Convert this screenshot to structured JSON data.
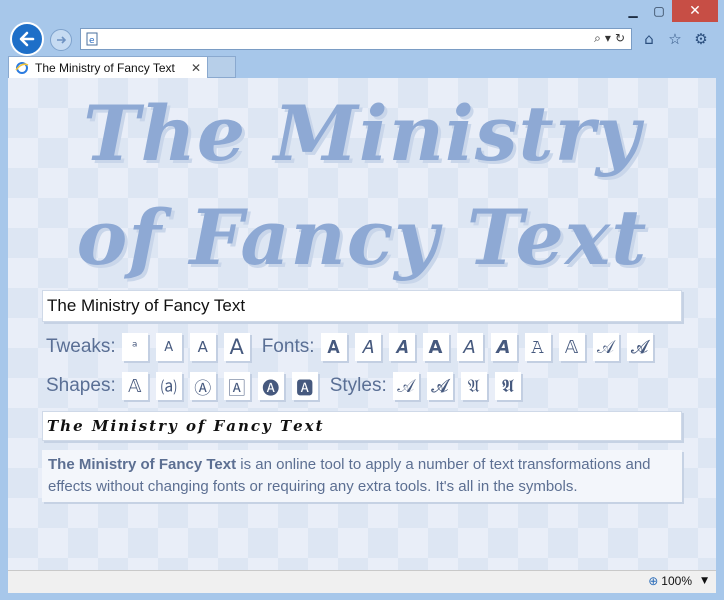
{
  "browser": {
    "tab_title": "The Ministry of Fancy Text",
    "zoom": "100%",
    "icons": [
      "back-icon",
      "forward-icon",
      "search-icon",
      "refresh-icon",
      "home-icon",
      "favorites-icon",
      "settings-icon"
    ]
  },
  "page": {
    "hero_line1": "The Ministry",
    "hero_line2": "of Fancy Text",
    "input_value": "The Ministry of Fancy Text",
    "tweaks_label": "Tweaks:",
    "tweak_buttons": [
      "ᵃ",
      "A",
      "A",
      "A"
    ],
    "fonts_label": "Fonts:",
    "font_buttons": [
      "𝐀",
      "𝐴",
      "𝑨",
      "𝗔",
      "𝘈",
      "𝘼",
      "𝙰",
      "𝔸",
      "𝒜",
      "𝓐"
    ],
    "shapes_label": "Shapes:",
    "shape_buttons": [
      "𝔸",
      "⒜",
      "Ⓐ",
      "🄰",
      "🅐",
      "🅰"
    ],
    "styles_label": "Styles:",
    "style_buttons": [
      "𝒜",
      "𝓐",
      "𝔄",
      "𝕬"
    ],
    "output_value": "𝑻𝒉𝒆 𝑴𝒊𝒏𝒊𝒔𝒕𝒓𝒚 𝒐𝒇 𝑭𝒂𝒏𝒄𝒚 𝑻𝒆𝒙𝒕",
    "description_bold": "The Ministry of Fancy Text",
    "description_rest": " is an online tool to apply a number of text transformations and effects without changing fonts or requiring any extra tools. It's all in the symbols."
  },
  "colors": {
    "accent": "#8ea9d4",
    "label": "#5a6f95",
    "close": "#c74e45"
  }
}
